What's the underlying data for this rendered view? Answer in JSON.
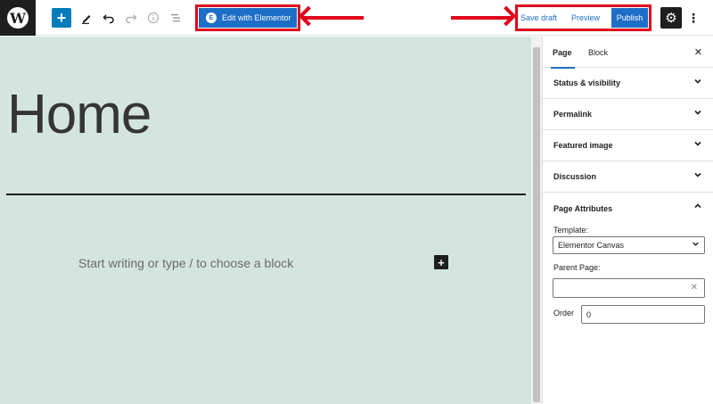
{
  "toolbar": {
    "wp_logo": "W",
    "inserter_icon": "+",
    "tools_icon": "pencil-icon",
    "undo_icon": "undo-icon",
    "redo_icon": "redo-icon",
    "info_icon": "info-icon",
    "list_view_icon": "list-view-icon",
    "elementor_label": "Edit with Elementor",
    "elementor_icon": "E",
    "save_draft_label": "Save draft",
    "preview_label": "Preview",
    "publish_label": "Publish",
    "settings_icon": "gear-icon",
    "options_icon": "⋮"
  },
  "editor": {
    "title": "Home",
    "placeholder": "Start writing or type / to choose a block",
    "add_block_icon": "+"
  },
  "sidebar": {
    "tabs": [
      {
        "label": "Page",
        "active": true
      },
      {
        "label": "Block",
        "active": false
      }
    ],
    "close_icon": "✕",
    "panels": [
      {
        "label": "Status & visibility",
        "expanded": false
      },
      {
        "label": "Permalink",
        "expanded": false
      },
      {
        "label": "Featured image",
        "expanded": false
      },
      {
        "label": "Discussion",
        "expanded": false
      },
      {
        "label": "Page Attributes",
        "expanded": true
      }
    ],
    "attributes": {
      "template_label": "Template:",
      "template_value": "Elementor Canvas",
      "parent_label": "Parent Page:",
      "parent_value": "",
      "order_label": "Order",
      "order_value": "0"
    }
  },
  "colors": {
    "accent": "#1d6ec6",
    "highlight": "#e0001b",
    "canvas_bg": "#d4e5df"
  }
}
